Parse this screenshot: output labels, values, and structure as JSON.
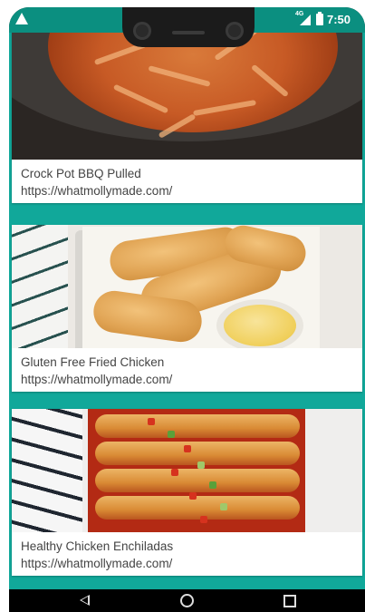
{
  "status_bar": {
    "time": "7:50",
    "network": "4G",
    "icons": [
      "warning-icon",
      "signal-icon",
      "battery-icon"
    ]
  },
  "colors": {
    "accent": "#11a89a",
    "status_bar": "#0b8f80",
    "card_text": "#444444",
    "nav_bar": "#000000"
  },
  "recipes": [
    {
      "title": "Crock Pot BBQ Pulled",
      "url": "https://whatmollymade.com/"
    },
    {
      "title": "Gluten Free Fried Chicken",
      "url": "https://whatmollymade.com/"
    },
    {
      "title": "Healthy Chicken Enchiladas",
      "url": "https://whatmollymade.com/"
    }
  ],
  "nav_bar": {
    "icons": [
      "back-icon",
      "home-icon",
      "recents-icon"
    ]
  }
}
